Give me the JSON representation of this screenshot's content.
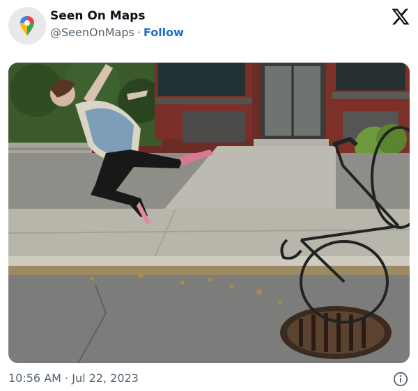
{
  "tweet": {
    "author_name": "Seen On Maps",
    "handle": "@SeenOnMaps",
    "separator": "·",
    "follow_label": "Follow",
    "timestamp_time": "10:56 AM",
    "timestamp_date": "Jul 22, 2023",
    "icons": {
      "avatar": "google-maps-pin-icon",
      "platform": "x-logo-icon",
      "info": "info-icon"
    },
    "colors": {
      "follow": "#1d6fc9",
      "text": "#0f1419",
      "muted": "#536471"
    },
    "photo": {
      "subject": "woman-falling-bicycle-collapsed-over-storm-drain"
    }
  }
}
